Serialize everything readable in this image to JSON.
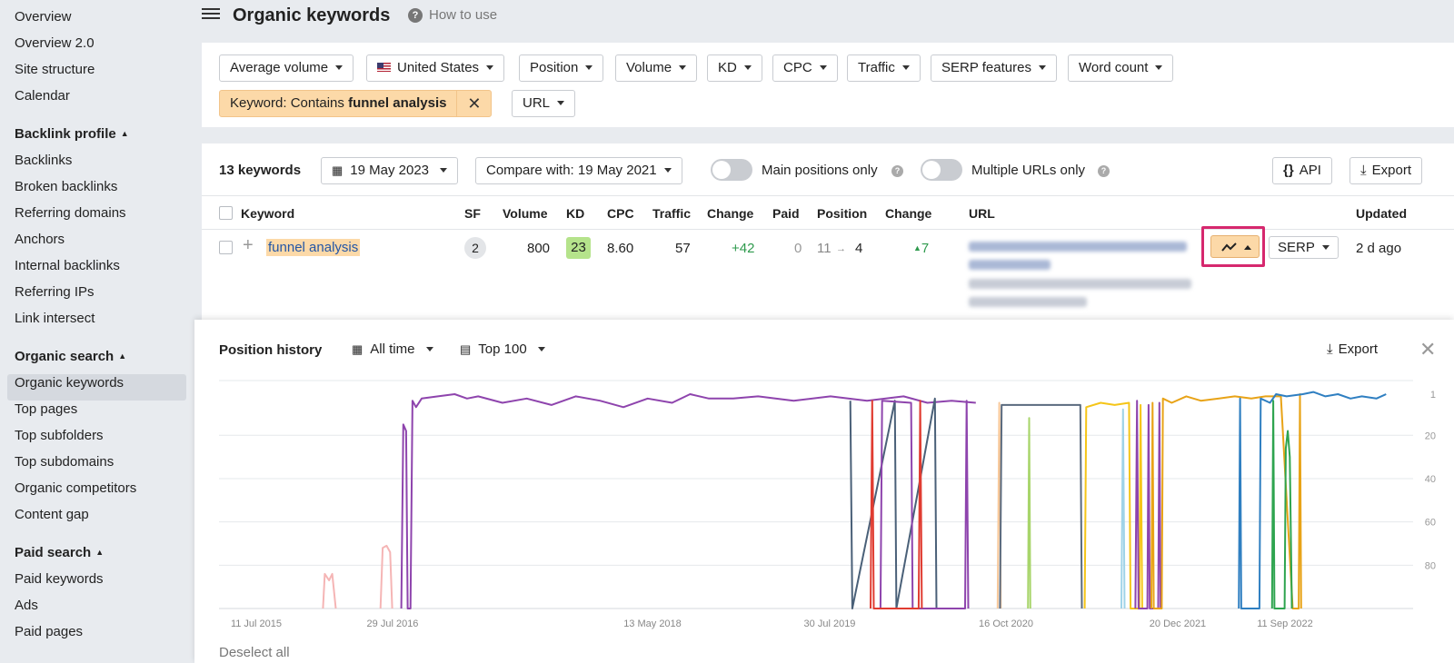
{
  "sidebar": {
    "items_top": [
      "Overview",
      "Overview 2.0",
      "Site structure",
      "Calendar"
    ],
    "backlink_heading": "Backlink profile",
    "backlink_items": [
      "Backlinks",
      "Broken backlinks",
      "Referring domains",
      "Anchors",
      "Internal backlinks",
      "Referring IPs",
      "Link intersect"
    ],
    "organic_heading": "Organic search",
    "organic_items": [
      "Organic keywords",
      "Top pages",
      "Top subfolders",
      "Top subdomains",
      "Organic competitors",
      "Content gap"
    ],
    "paid_heading": "Paid search",
    "paid_items": [
      "Paid keywords",
      "Ads",
      "Paid pages"
    ],
    "active_item": "Organic keywords"
  },
  "header": {
    "title": "Organic keywords",
    "help_label": "How to use"
  },
  "filters": {
    "row1": [
      "Average volume",
      "United States",
      "Position",
      "Volume",
      "KD",
      "CPC",
      "Traffic",
      "SERP features",
      "Word count"
    ],
    "keyword_filter_prefix": "Keyword: Contains ",
    "keyword_filter_value": "funnel analysis",
    "url_label": "URL"
  },
  "toolbar": {
    "count": "13 keywords",
    "date": "19 May 2023",
    "compare": "Compare with: 19 May 2021",
    "main_positions": "Main positions only",
    "multiple_urls": "Multiple URLs only",
    "api": "API",
    "export": "Export"
  },
  "table": {
    "headers": [
      "Keyword",
      "SF",
      "Volume",
      "KD",
      "CPC",
      "Traffic",
      "Change",
      "Paid",
      "Position",
      "Change",
      "URL",
      "Updated"
    ],
    "row": {
      "keyword": "funnel analysis",
      "sf": "2",
      "volume": "800",
      "kd": "23",
      "cpc": "8.60",
      "traffic": "57",
      "change": "+42",
      "paid": "0",
      "position_from": "11",
      "position_to": "4",
      "position_change": "7",
      "serp": "SERP",
      "updated": "2 d ago"
    }
  },
  "history": {
    "title": "Position history",
    "range": "All time",
    "top": "Top 100",
    "export": "Export",
    "deselect": "Deselect all"
  },
  "colors": {
    "accent_orange": "#fcd9a8",
    "highlight_frame": "#d6286e",
    "kd_green": "#b5e38b",
    "positive": "#2e9a4d",
    "link": "#2356a6"
  },
  "chart_data": {
    "type": "line",
    "x_tick_labels": [
      "11 Jul 2015",
      "29 Jul 2016",
      "13 May 2018",
      "30 Jul 2019",
      "16 Oct 2020",
      "20 Dec 2021",
      "11 Sep 2022"
    ],
    "y_ticks": [
      1,
      20,
      40,
      60,
      80
    ],
    "ylim": [
      1,
      100
    ],
    "y_inverted": true,
    "grid": true,
    "series": [
      {
        "color": "#f5b5b5",
        "points": [
          [
            "2016-01-15",
            100
          ],
          [
            "2016-01-20",
            84
          ],
          [
            "2016-02-01",
            87
          ],
          [
            "2016-02-10",
            84
          ],
          [
            "2016-02-20",
            100
          ]
        ]
      },
      {
        "color": "#f5b5b5",
        "points": [
          [
            "2016-06-25",
            100
          ],
          [
            "2016-07-01",
            72
          ],
          [
            "2016-07-12",
            71
          ],
          [
            "2016-07-22",
            74
          ],
          [
            "2016-07-28",
            100
          ]
        ]
      },
      {
        "color": "#8e44ad",
        "points": [
          [
            "2016-08-20",
            100
          ],
          [
            "2016-08-25",
            15
          ],
          [
            "2016-09-01",
            18
          ],
          [
            "2016-09-05",
            100
          ],
          [
            "2016-09-12",
            100
          ],
          [
            "2016-09-17",
            4
          ],
          [
            "2016-09-26",
            7
          ],
          [
            "2016-10-10",
            3
          ],
          [
            "2016-11-20",
            2
          ],
          [
            "2017-01-01",
            1
          ],
          [
            "2017-02-01",
            3
          ],
          [
            "2017-03-01",
            2
          ],
          [
            "2017-05-01",
            5
          ],
          [
            "2017-07-01",
            3
          ],
          [
            "2017-09-01",
            6
          ],
          [
            "2017-11-01",
            2
          ],
          [
            "2018-01-01",
            4
          ],
          [
            "2018-03-01",
            7
          ],
          [
            "2018-05-01",
            3
          ],
          [
            "2018-07-01",
            5
          ],
          [
            "2018-08-15",
            1
          ],
          [
            "2018-10-01",
            3
          ],
          [
            "2018-12-01",
            3
          ],
          [
            "2019-02-01",
            2
          ],
          [
            "2019-05-01",
            4
          ],
          [
            "2019-08-01",
            2
          ],
          [
            "2019-11-01",
            4
          ],
          [
            "2020-02-01",
            2
          ],
          [
            "2020-04-01",
            5
          ],
          [
            "2020-06-01",
            4
          ],
          [
            "2020-08-01",
            5
          ]
        ]
      },
      {
        "color": "#4a6078",
        "points": [
          [
            "2019-09-20",
            4
          ],
          [
            "2019-09-25",
            100
          ],
          [
            "2020-01-10",
            4
          ],
          [
            "2020-01-14",
            100
          ],
          [
            "2020-04-20",
            3
          ],
          [
            "2020-04-24",
            100
          ]
        ]
      },
      {
        "color": "#8e44ad",
        "points": [
          [
            "2019-12-05",
            100
          ],
          [
            "2019-12-09",
            4
          ],
          [
            "2020-02-20",
            5
          ],
          [
            "2020-02-24",
            100
          ],
          [
            "2020-07-05",
            100
          ],
          [
            "2020-07-09",
            4
          ],
          [
            "2020-07-13",
            100
          ]
        ]
      },
      {
        "color": "#e03c31",
        "points": [
          [
            "2019-11-10",
            100
          ],
          [
            "2019-11-14",
            4
          ],
          [
            "2019-11-18",
            100
          ],
          [
            "2020-03-10",
            100
          ],
          [
            "2020-03-14",
            4
          ],
          [
            "2020-03-18",
            100
          ]
        ]
      },
      {
        "color": "#f7c89a",
        "points": [
          [
            "2020-09-25",
            100
          ],
          [
            "2020-09-29",
            5
          ],
          [
            "2020-10-03",
            100
          ]
        ]
      },
      {
        "color": "#5a6a7e",
        "points": [
          [
            "2020-10-01",
            100
          ],
          [
            "2020-10-05",
            6
          ],
          [
            "2021-04-20",
            6
          ],
          [
            "2021-04-24",
            100
          ]
        ]
      },
      {
        "color": "#a8d56b",
        "points": [
          [
            "2020-12-10",
            100
          ],
          [
            "2020-12-13",
            12
          ],
          [
            "2020-12-16",
            100
          ]
        ]
      },
      {
        "color": "#f5c518",
        "points": [
          [
            "2021-05-01",
            100
          ],
          [
            "2021-05-05",
            7
          ],
          [
            "2021-06-10",
            5
          ],
          [
            "2021-07-15",
            6
          ],
          [
            "2021-08-20",
            5
          ],
          [
            "2021-08-24",
            100
          ],
          [
            "2021-09-15",
            100
          ],
          [
            "2021-09-18",
            6
          ],
          [
            "2021-09-22",
            100
          ]
        ]
      },
      {
        "color": "#9fd3e8",
        "points": [
          [
            "2021-08-01",
            100
          ],
          [
            "2021-08-05",
            8
          ],
          [
            "2021-08-09",
            100
          ]
        ]
      },
      {
        "color": "#8e44ad",
        "points": [
          [
            "2021-09-05",
            100
          ],
          [
            "2021-09-09",
            4
          ],
          [
            "2021-09-13",
            100
          ],
          [
            "2021-10-05",
            100
          ],
          [
            "2021-10-08",
            6
          ],
          [
            "2021-10-11",
            100
          ],
          [
            "2021-11-01",
            100
          ],
          [
            "2021-11-04",
            5
          ],
          [
            "2021-11-07",
            100
          ]
        ]
      },
      {
        "color": "#e8a317",
        "points": [
          [
            "2021-10-15",
            100
          ],
          [
            "2021-10-18",
            5
          ],
          [
            "2021-10-21",
            100
          ],
          [
            "2021-11-10",
            100
          ],
          [
            "2021-11-13",
            3
          ],
          [
            "2021-12-05",
            5
          ],
          [
            "2022-01-10",
            2
          ],
          [
            "2022-02-15",
            4
          ],
          [
            "2022-04-01",
            3
          ],
          [
            "2022-05-10",
            2
          ],
          [
            "2022-06-20",
            3
          ],
          [
            "2022-07-25",
            2
          ],
          [
            "2022-09-01",
            2
          ],
          [
            "2022-09-30",
            100
          ],
          [
            "2022-10-15",
            100
          ],
          [
            "2022-10-18",
            1
          ],
          [
            "2022-10-21",
            100
          ]
        ]
      },
      {
        "color": "#2f7fc1",
        "points": [
          [
            "2022-05-20",
            100
          ],
          [
            "2022-05-23",
            3
          ],
          [
            "2022-05-26",
            100
          ],
          [
            "2022-07-10",
            100
          ],
          [
            "2022-07-13",
            3
          ],
          [
            "2022-08-05",
            5
          ],
          [
            "2022-08-20",
            1
          ],
          [
            "2022-09-15",
            2
          ],
          [
            "2022-10-25",
            1
          ],
          [
            "2022-11-20",
            0
          ],
          [
            "2022-12-20",
            2
          ],
          [
            "2023-01-20",
            1
          ],
          [
            "2023-02-20",
            3
          ],
          [
            "2023-03-20",
            2
          ],
          [
            "2023-04-25",
            3
          ],
          [
            "2023-05-19",
            1
          ]
        ]
      },
      {
        "color": "#2ea44f",
        "points": [
          [
            "2022-08-10",
            100
          ],
          [
            "2022-08-13",
            4
          ],
          [
            "2022-08-16",
            100
          ],
          [
            "2022-09-10",
            100
          ],
          [
            "2022-09-13",
            26
          ],
          [
            "2022-09-18",
            18
          ],
          [
            "2022-09-23",
            30
          ],
          [
            "2022-09-28",
            100
          ]
        ]
      }
    ]
  }
}
